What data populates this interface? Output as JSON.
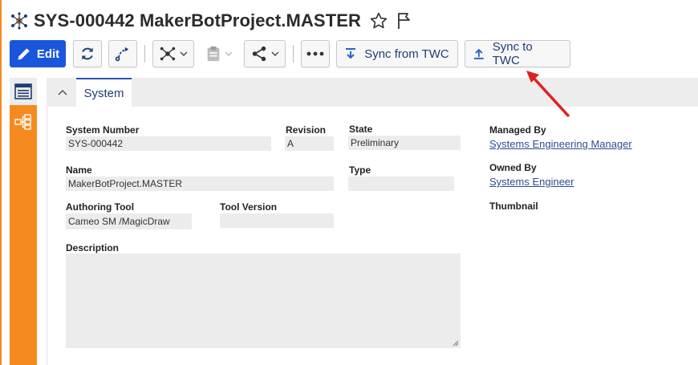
{
  "header": {
    "title": "SYS-000442 MakerBotProject.MASTER"
  },
  "toolbar": {
    "edit_label": "Edit",
    "sync_from_label": "Sync from TWC",
    "sync_to_label": "Sync to TWC"
  },
  "tabs": [
    {
      "label": "System"
    }
  ],
  "fields": {
    "system_number": {
      "label": "System Number",
      "value": "SYS-000442"
    },
    "revision": {
      "label": "Revision",
      "value": "A"
    },
    "state": {
      "label": "State",
      "value": "Preliminary"
    },
    "name": {
      "label": "Name",
      "value": "MakerBotProject.MASTER"
    },
    "type": {
      "label": "Type",
      "value": ""
    },
    "authoring_tool": {
      "label": "Authoring Tool",
      "value": "Cameo SM /MagicDraw"
    },
    "tool_version": {
      "label": "Tool Version",
      "value": ""
    },
    "description": {
      "label": "Description",
      "value": ""
    }
  },
  "side": {
    "managed_by": {
      "label": "Managed By",
      "value": "Systems Engineering Manager"
    },
    "owned_by": {
      "label": "Owned By",
      "value": "Systems Engineer"
    },
    "thumbnail": {
      "label": "Thumbnail"
    }
  },
  "colors": {
    "accent_orange": "#f58a1f",
    "primary_blue": "#1a56db",
    "link_blue": "#2b4f8f",
    "annotation_red": "#e02020"
  },
  "icons": [
    "system-icon",
    "star-icon",
    "flag-icon",
    "pencil-icon",
    "refresh-icon",
    "path-icon",
    "network-icon",
    "clipboard-icon",
    "share-icon",
    "more-icon",
    "download-icon",
    "upload-icon",
    "form-icon",
    "tree-icon",
    "chevron-up-icon"
  ]
}
